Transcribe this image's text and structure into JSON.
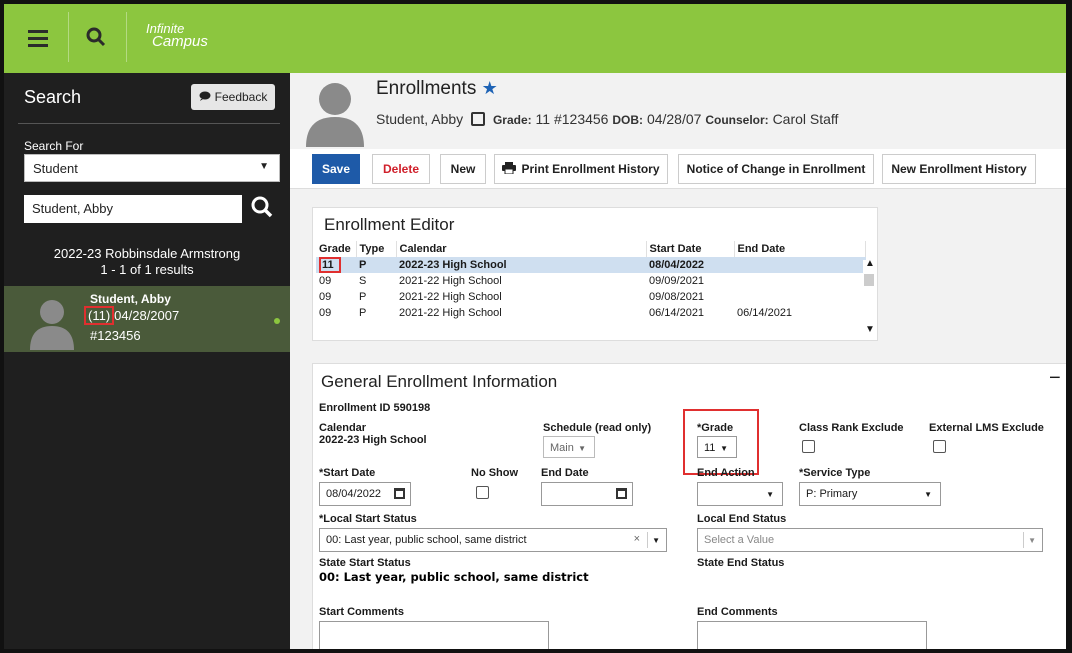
{
  "topbar": {
    "brand_line1": "Infinite",
    "brand_line2": "Campus"
  },
  "sidebar": {
    "title": "Search",
    "feedback_label": "Feedback",
    "search_for_label": "Search For",
    "search_for_value": "Student",
    "search_input_value": "Student, Abby",
    "result_school": "2022-23 Robbinsdale Armstrong",
    "result_count": "1 - 1 of 1 results",
    "result": {
      "name": "Student, Abby",
      "grade": "(11)",
      "dob": "04/28/2007",
      "id": "#123456"
    }
  },
  "header": {
    "title": "Enrollments",
    "name": "Student, Abby",
    "grade_label": "Grade:",
    "grade_value": "11 #123456",
    "dob_label": "DOB:",
    "dob_value": "04/28/07",
    "counselor_label": "Counselor:",
    "counselor_value": "Carol Staff"
  },
  "toolbar": {
    "save": "Save",
    "delete": "Delete",
    "new": "New",
    "print": "Print Enrollment History",
    "notice": "Notice of Change in Enrollment",
    "new_history": "New Enrollment History"
  },
  "editor": {
    "title": "Enrollment Editor",
    "columns": [
      "Grade",
      "Type",
      "Calendar",
      "Start Date",
      "End Date"
    ],
    "rows": [
      [
        "11",
        "P",
        "2022-23 High School",
        "08/04/2022",
        ""
      ],
      [
        "09",
        "S",
        "2021-22 High School",
        "09/09/2021",
        ""
      ],
      [
        "09",
        "P",
        "2021-22 High School",
        "09/08/2021",
        ""
      ],
      [
        "09",
        "P",
        "2021-22 High School",
        "06/14/2021",
        "06/14/2021"
      ]
    ]
  },
  "general": {
    "title": "General Enrollment Information",
    "collapse": "−",
    "enrollment_id": "Enrollment ID 590198",
    "calendar_label": "Calendar",
    "calendar_value": "2022-23 High School",
    "schedule_label": "Schedule (read only)",
    "schedule_value": "Main",
    "grade_label": "*Grade",
    "grade_value": "11",
    "class_rank_label": "Class Rank Exclude",
    "external_lms_label": "External LMS Exclude",
    "start_date_label": "*Start Date",
    "start_date_value": "08/04/2022",
    "no_show_label": "No Show",
    "end_date_label": "End Date",
    "end_action_label": "End Action",
    "service_type_label": "*Service Type",
    "service_type_value": "P: Primary",
    "local_start_label": "*Local Start Status",
    "local_start_value": "00: Last year, public school, same district",
    "local_end_label": "Local End Status",
    "local_end_placeholder": "Select a Value",
    "state_start_label": "State Start Status",
    "state_start_value": "00: Last year, public school, same district",
    "state_end_label": "State End Status",
    "start_comments_label": "Start Comments",
    "end_comments_label": "End Comments"
  }
}
